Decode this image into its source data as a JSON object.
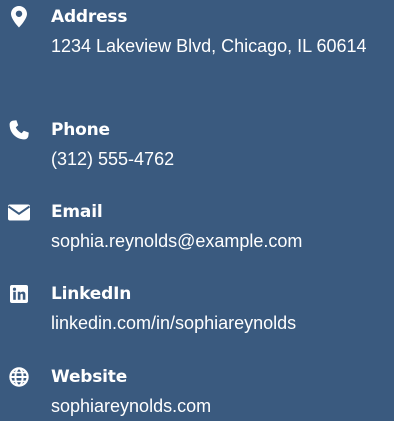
{
  "contacts": {
    "address": {
      "label": "Address",
      "value": "1234 Lakeview Blvd, Chicago, IL 60614",
      "icon": "map-marker-icon"
    },
    "phone": {
      "label": "Phone",
      "value": "(312) 555-4762",
      "icon": "phone-icon"
    },
    "email": {
      "label": "Email",
      "value": "sophia.reynolds@example.com",
      "icon": "envelope-icon"
    },
    "linkedin": {
      "label": "LinkedIn",
      "value": "linkedin.com/in/sophiareynolds",
      "icon": "linkedin-icon"
    },
    "website": {
      "label": "Website",
      "value": "sophiareynolds.com",
      "icon": "globe-icon"
    }
  },
  "colors": {
    "background": "#3a5a7f",
    "text": "#ffffff"
  }
}
